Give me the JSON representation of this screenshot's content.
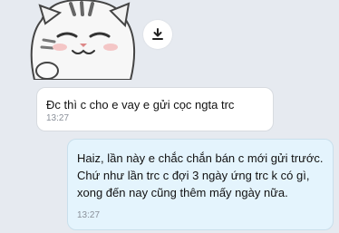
{
  "chat": {
    "sticker": {
      "icon": "cat-sticker"
    },
    "download_button": {
      "icon": "download-icon"
    },
    "messages": [
      {
        "direction": "incoming",
        "text": "Đc thì c cho e vay e gửi cọc ngta trc",
        "time": "13:27"
      },
      {
        "direction": "outgoing",
        "text": "Haiz, lần này e chắc chắn bán c mới gửi trước. Chứ như lần trc c đợi 3 ngày ứng trc k có gì, xong đến nay cũng thêm mấy ngày nữa.",
        "time": "13:27"
      }
    ]
  },
  "colors": {
    "background": "#e6eaf0",
    "incoming_bubble": "#ffffff",
    "outgoing_bubble": "#e4f4fd",
    "timestamp": "#8a9099"
  }
}
